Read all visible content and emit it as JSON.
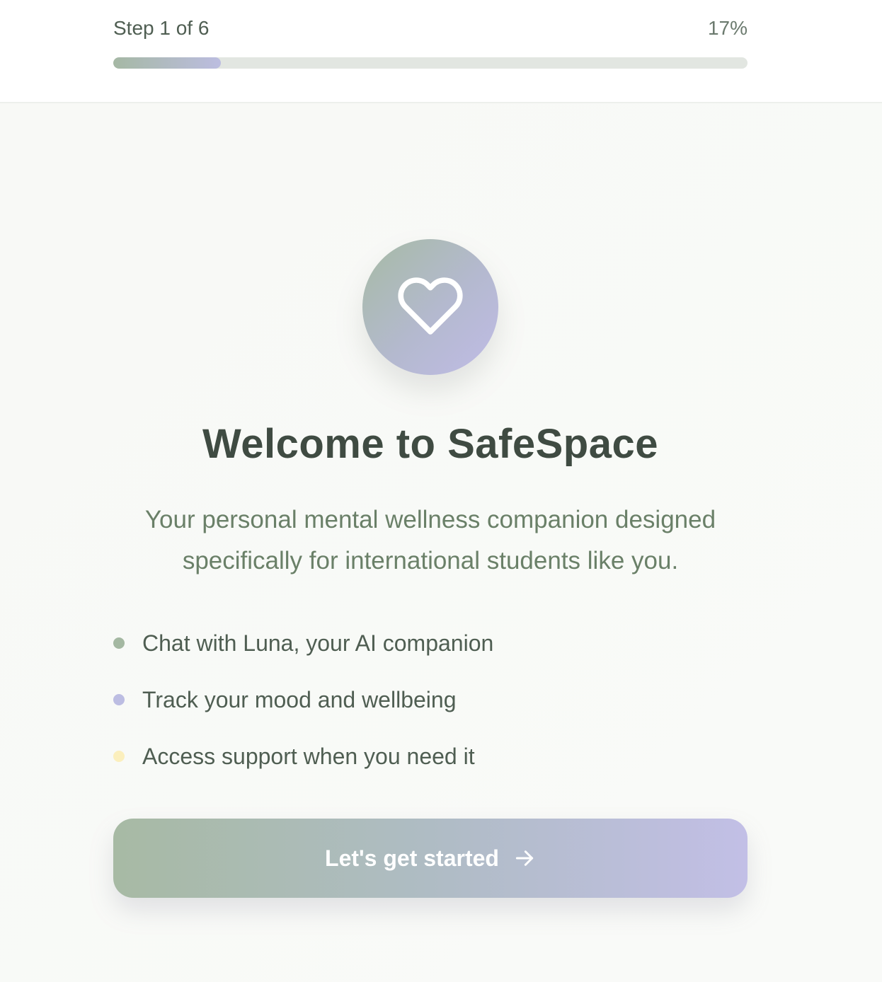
{
  "progress": {
    "step_label": "Step 1 of 6",
    "percent_label": "17%",
    "value": 0.17,
    "gradient_start": "#a5b8a4",
    "gradient_end": "#bcbde0",
    "track_color": "#e2e6e1"
  },
  "hero": {
    "icon": "heart-icon",
    "gradient_start": "#a6bba4",
    "gradient_end": "#c0bce6"
  },
  "title": "Welcome to SafeSpace",
  "subtitle_lines": [
    "Your personal mental wellness companion designed",
    "specifically for international students like you."
  ],
  "features": [
    {
      "text": "Chat with Luna, your AI companion",
      "dot_color": "#a4b8a2"
    },
    {
      "text": "Track your mood and wellbeing",
      "dot_color": "#bcbde2"
    },
    {
      "text": "Access support when you need it",
      "dot_color": "#fbefbd"
    }
  ],
  "cta": {
    "label": "Let's get started",
    "icon": "arrow-right-icon"
  }
}
